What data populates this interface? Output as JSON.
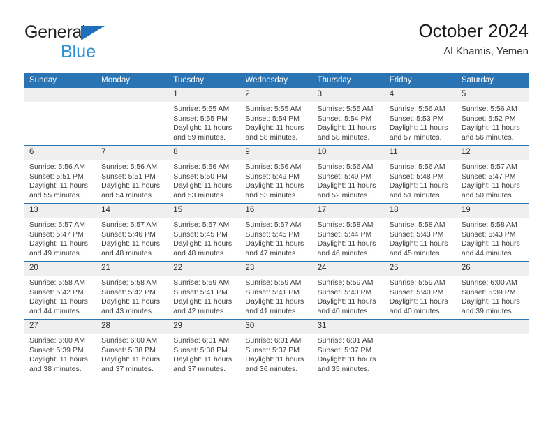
{
  "brand": {
    "name_line1": "General",
    "name_line2": "Blue",
    "triangle_icon": "triangle-icon"
  },
  "header": {
    "title": "October 2024",
    "subtitle": "Al Khamis, Yemen"
  },
  "colors": {
    "header_blue": "#2b74b3",
    "brand_blue": "#2a8fd4",
    "daynum_band": "#efefef",
    "text": "#3d3d3d"
  },
  "calendar": {
    "weekdays": [
      "Sunday",
      "Monday",
      "Tuesday",
      "Wednesday",
      "Thursday",
      "Friday",
      "Saturday"
    ],
    "weeks": [
      [
        {
          "day": "",
          "sunrise": "",
          "sunset": "",
          "daylight1": "",
          "daylight2": ""
        },
        {
          "day": "",
          "sunrise": "",
          "sunset": "",
          "daylight1": "",
          "daylight2": ""
        },
        {
          "day": "1",
          "sunrise": "Sunrise: 5:55 AM",
          "sunset": "Sunset: 5:55 PM",
          "daylight1": "Daylight: 11 hours",
          "daylight2": "and 59 minutes."
        },
        {
          "day": "2",
          "sunrise": "Sunrise: 5:55 AM",
          "sunset": "Sunset: 5:54 PM",
          "daylight1": "Daylight: 11 hours",
          "daylight2": "and 58 minutes."
        },
        {
          "day": "3",
          "sunrise": "Sunrise: 5:55 AM",
          "sunset": "Sunset: 5:54 PM",
          "daylight1": "Daylight: 11 hours",
          "daylight2": "and 58 minutes."
        },
        {
          "day": "4",
          "sunrise": "Sunrise: 5:56 AM",
          "sunset": "Sunset: 5:53 PM",
          "daylight1": "Daylight: 11 hours",
          "daylight2": "and 57 minutes."
        },
        {
          "day": "5",
          "sunrise": "Sunrise: 5:56 AM",
          "sunset": "Sunset: 5:52 PM",
          "daylight1": "Daylight: 11 hours",
          "daylight2": "and 56 minutes."
        }
      ],
      [
        {
          "day": "6",
          "sunrise": "Sunrise: 5:56 AM",
          "sunset": "Sunset: 5:51 PM",
          "daylight1": "Daylight: 11 hours",
          "daylight2": "and 55 minutes."
        },
        {
          "day": "7",
          "sunrise": "Sunrise: 5:56 AM",
          "sunset": "Sunset: 5:51 PM",
          "daylight1": "Daylight: 11 hours",
          "daylight2": "and 54 minutes."
        },
        {
          "day": "8",
          "sunrise": "Sunrise: 5:56 AM",
          "sunset": "Sunset: 5:50 PM",
          "daylight1": "Daylight: 11 hours",
          "daylight2": "and 53 minutes."
        },
        {
          "day": "9",
          "sunrise": "Sunrise: 5:56 AM",
          "sunset": "Sunset: 5:49 PM",
          "daylight1": "Daylight: 11 hours",
          "daylight2": "and 53 minutes."
        },
        {
          "day": "10",
          "sunrise": "Sunrise: 5:56 AM",
          "sunset": "Sunset: 5:49 PM",
          "daylight1": "Daylight: 11 hours",
          "daylight2": "and 52 minutes."
        },
        {
          "day": "11",
          "sunrise": "Sunrise: 5:56 AM",
          "sunset": "Sunset: 5:48 PM",
          "daylight1": "Daylight: 11 hours",
          "daylight2": "and 51 minutes."
        },
        {
          "day": "12",
          "sunrise": "Sunrise: 5:57 AM",
          "sunset": "Sunset: 5:47 PM",
          "daylight1": "Daylight: 11 hours",
          "daylight2": "and 50 minutes."
        }
      ],
      [
        {
          "day": "13",
          "sunrise": "Sunrise: 5:57 AM",
          "sunset": "Sunset: 5:47 PM",
          "daylight1": "Daylight: 11 hours",
          "daylight2": "and 49 minutes."
        },
        {
          "day": "14",
          "sunrise": "Sunrise: 5:57 AM",
          "sunset": "Sunset: 5:46 PM",
          "daylight1": "Daylight: 11 hours",
          "daylight2": "and 48 minutes."
        },
        {
          "day": "15",
          "sunrise": "Sunrise: 5:57 AM",
          "sunset": "Sunset: 5:45 PM",
          "daylight1": "Daylight: 11 hours",
          "daylight2": "and 48 minutes."
        },
        {
          "day": "16",
          "sunrise": "Sunrise: 5:57 AM",
          "sunset": "Sunset: 5:45 PM",
          "daylight1": "Daylight: 11 hours",
          "daylight2": "and 47 minutes."
        },
        {
          "day": "17",
          "sunrise": "Sunrise: 5:58 AM",
          "sunset": "Sunset: 5:44 PM",
          "daylight1": "Daylight: 11 hours",
          "daylight2": "and 46 minutes."
        },
        {
          "day": "18",
          "sunrise": "Sunrise: 5:58 AM",
          "sunset": "Sunset: 5:43 PM",
          "daylight1": "Daylight: 11 hours",
          "daylight2": "and 45 minutes."
        },
        {
          "day": "19",
          "sunrise": "Sunrise: 5:58 AM",
          "sunset": "Sunset: 5:43 PM",
          "daylight1": "Daylight: 11 hours",
          "daylight2": "and 44 minutes."
        }
      ],
      [
        {
          "day": "20",
          "sunrise": "Sunrise: 5:58 AM",
          "sunset": "Sunset: 5:42 PM",
          "daylight1": "Daylight: 11 hours",
          "daylight2": "and 44 minutes."
        },
        {
          "day": "21",
          "sunrise": "Sunrise: 5:58 AM",
          "sunset": "Sunset: 5:42 PM",
          "daylight1": "Daylight: 11 hours",
          "daylight2": "and 43 minutes."
        },
        {
          "day": "22",
          "sunrise": "Sunrise: 5:59 AM",
          "sunset": "Sunset: 5:41 PM",
          "daylight1": "Daylight: 11 hours",
          "daylight2": "and 42 minutes."
        },
        {
          "day": "23",
          "sunrise": "Sunrise: 5:59 AM",
          "sunset": "Sunset: 5:41 PM",
          "daylight1": "Daylight: 11 hours",
          "daylight2": "and 41 minutes."
        },
        {
          "day": "24",
          "sunrise": "Sunrise: 5:59 AM",
          "sunset": "Sunset: 5:40 PM",
          "daylight1": "Daylight: 11 hours",
          "daylight2": "and 40 minutes."
        },
        {
          "day": "25",
          "sunrise": "Sunrise: 5:59 AM",
          "sunset": "Sunset: 5:40 PM",
          "daylight1": "Daylight: 11 hours",
          "daylight2": "and 40 minutes."
        },
        {
          "day": "26",
          "sunrise": "Sunrise: 6:00 AM",
          "sunset": "Sunset: 5:39 PM",
          "daylight1": "Daylight: 11 hours",
          "daylight2": "and 39 minutes."
        }
      ],
      [
        {
          "day": "27",
          "sunrise": "Sunrise: 6:00 AM",
          "sunset": "Sunset: 5:39 PM",
          "daylight1": "Daylight: 11 hours",
          "daylight2": "and 38 minutes."
        },
        {
          "day": "28",
          "sunrise": "Sunrise: 6:00 AM",
          "sunset": "Sunset: 5:38 PM",
          "daylight1": "Daylight: 11 hours",
          "daylight2": "and 37 minutes."
        },
        {
          "day": "29",
          "sunrise": "Sunrise: 6:01 AM",
          "sunset": "Sunset: 5:38 PM",
          "daylight1": "Daylight: 11 hours",
          "daylight2": "and 37 minutes."
        },
        {
          "day": "30",
          "sunrise": "Sunrise: 6:01 AM",
          "sunset": "Sunset: 5:37 PM",
          "daylight1": "Daylight: 11 hours",
          "daylight2": "and 36 minutes."
        },
        {
          "day": "31",
          "sunrise": "Sunrise: 6:01 AM",
          "sunset": "Sunset: 5:37 PM",
          "daylight1": "Daylight: 11 hours",
          "daylight2": "and 35 minutes."
        },
        {
          "day": "",
          "sunrise": "",
          "sunset": "",
          "daylight1": "",
          "daylight2": ""
        },
        {
          "day": "",
          "sunrise": "",
          "sunset": "",
          "daylight1": "",
          "daylight2": ""
        }
      ]
    ]
  }
}
